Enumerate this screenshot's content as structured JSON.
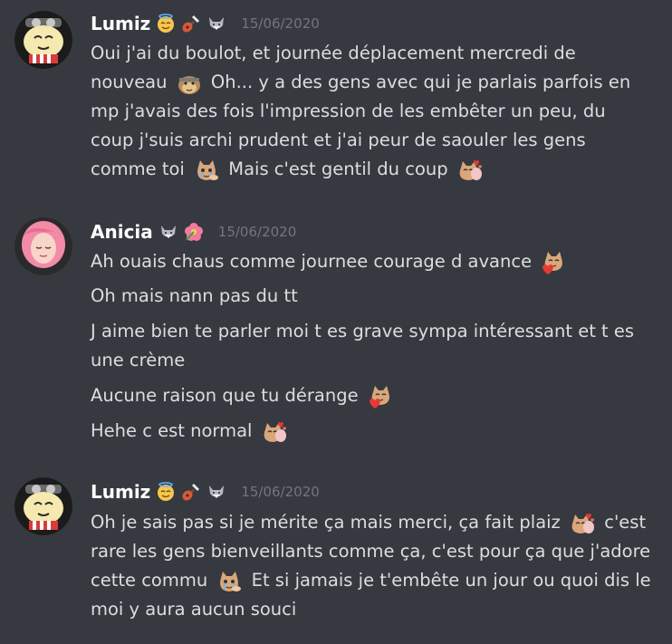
{
  "messages": [
    {
      "author": "Lumiz",
      "timestamp": "15/06/2020",
      "lines": [
        "Oui j'ai du boulot, et journée déplacement mercredi de",
        "nouveau",
        "Oh... y a des gens avec qui je parlais parfois en",
        "mp j'avais des fois l'impression de les embêter un peu, du",
        "coup j'suis archi prudent et j'ai peur de saouler les gens",
        "comme toi",
        "Mais c'est gentil du coup"
      ]
    },
    {
      "author": "Anicia",
      "timestamp": "15/06/2020",
      "lines": [
        "Ah ouais chaus comme journee courage d avance",
        "Oh mais nann pas du tt",
        "J aime bien te parler moi t es grave sympa intéressant et t es",
        "une crème",
        "Aucune raison que tu dérange",
        "Hehe c est normal"
      ]
    },
    {
      "author": "Lumiz",
      "timestamp": "15/06/2020",
      "lines": [
        "Oh je sais pas si je mérite ça mais merci, ça fait plaiz",
        "c'est",
        "rare les gens bienveillants comme ça, c'est pour ça que j'adore",
        "cette commu",
        "Et si jamais je t'embête un jour ou quoi dis le",
        "moi y aura aucun souci"
      ]
    }
  ],
  "icons": {
    "halo": "smiling-face-with-halo-icon",
    "guitar": "guitar-icon",
    "wolf": "wolf-icon",
    "flower": "hibiscus-icon",
    "monkey": "monkey-face-emote-icon",
    "cat_cry": "crying-cat-emote-icon",
    "cat_heart": "cat-heart-emote-icon",
    "cat_love": "cat-loving-emote-icon"
  },
  "colors": {
    "background": "#36393f",
    "username": "#ffffff",
    "message_text": "#dcddde",
    "timestamp": "#72767d"
  }
}
